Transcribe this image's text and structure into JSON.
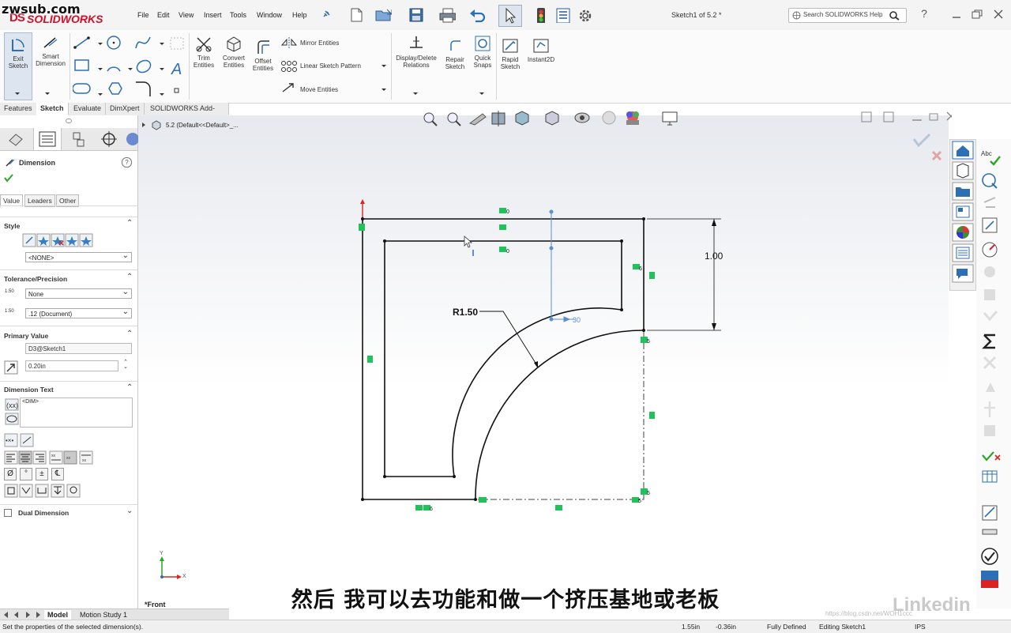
{
  "watermark": "zwsub.com",
  "app": {
    "logo_mark": "DS",
    "logo_text": "SOLIDWORKS"
  },
  "menu": [
    "File",
    "Edit",
    "View",
    "Insert",
    "Tools",
    "Window",
    "Help"
  ],
  "document_title": "Sketch1 of 5.2 *",
  "search": {
    "placeholder": "Search SOLIDWORKS Help"
  },
  "help_glyph": "?",
  "command_manager": {
    "exit_sketch": "Exit Sketch",
    "smart_dimension": "Smart Dimension",
    "trim_entities": "Trim Entities",
    "convert_entities": "Convert Entities",
    "offset_entities": "Offset Entities",
    "mirror_entities": "Mirror Entities",
    "linear_sketch_pattern": "Linear Sketch Pattern",
    "move_entities": "Move Entities",
    "display_delete_relations": "Display/Delete Relations",
    "repair_sketch": "Repair Sketch",
    "quick_snaps": "Quick Snaps",
    "rapid_sketch": "Rapid Sketch",
    "instant2d": "Instant2D"
  },
  "tabs": [
    "Features",
    "Sketch",
    "Evaluate",
    "DimXpert",
    "SOLIDWORKS Add-Ins"
  ],
  "active_tab": "Sketch",
  "tree": {
    "root": "5.2  (Default<<Default>_..."
  },
  "property_manager": {
    "title": "Dimension",
    "help": "?",
    "subtabs": [
      "Value",
      "Leaders",
      "Other"
    ],
    "style": {
      "title": "Style",
      "selection": "<NONE>"
    },
    "tolerance": {
      "title": "Tolerance/Precision",
      "tolerance_type": "None",
      "precision": ".12 (Document)",
      "tol_icon_text": "1.50",
      "prec_icon_text": "1.50"
    },
    "primary_value": {
      "title": "Primary Value",
      "name": "D3@Sketch1",
      "value": "0.20in"
    },
    "dimension_text": {
      "title": "Dimension Text",
      "text": "<DIM>"
    },
    "dual_dimension": {
      "title": "Dual Dimension"
    },
    "symbols": [
      "Ø",
      "°",
      "±",
      "℄"
    ]
  },
  "sketch": {
    "radius_label": "R1.50",
    "height_label": "1.00",
    "relation_labels": [
      "0",
      "0",
      "6",
      "5",
      "6",
      "5",
      "5"
    ],
    "dimension_preview": "30",
    "view_label": "*Front",
    "triad_x": "X",
    "triad_y": "Y"
  },
  "bottom_tabs": [
    "Model",
    "Motion Study 1"
  ],
  "status": {
    "message": "Set the properties of the selected dimension(s).",
    "x": "1.55in",
    "y": "-0.36in",
    "definition": "Fully Defined",
    "editing": "Editing Sketch1",
    "units": "IPS"
  },
  "right_bar_label": "Abc",
  "caption": "然后 我可以去功能和做一个挤压基地或老板",
  "brand_watermark": "Linkedin",
  "blog_watermark": "https://blog.csdn.net/WOH1ccc"
}
